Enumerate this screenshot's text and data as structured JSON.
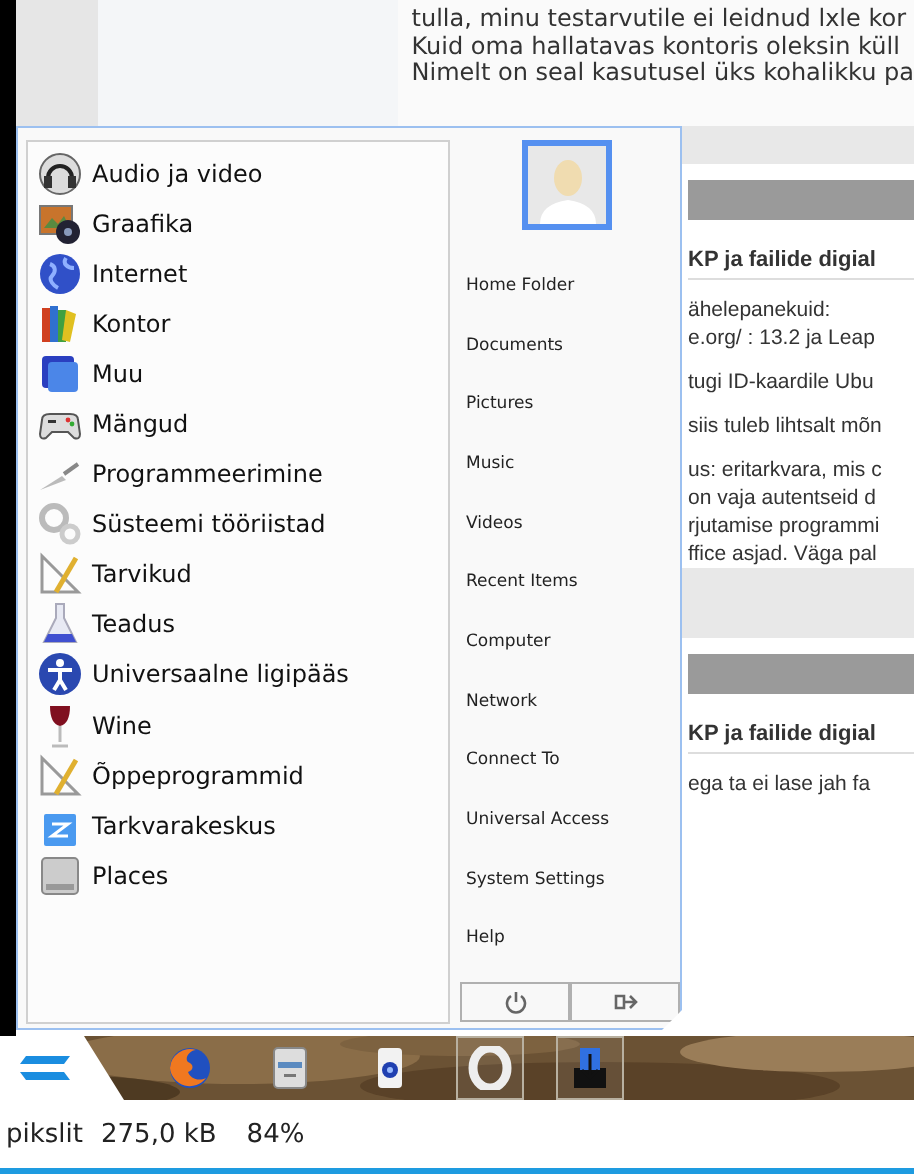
{
  "page": {
    "top_lines": [
      "tulla, minu testarvutile ei leidnud lxle kor",
      "Kuid oma hallatavas kontoris oleksin küll",
      "Nimelt on seal kasutusel üks kohalikku pa"
    ],
    "sections": [
      {
        "heading": "KP ja failide digial",
        "paragraphs": [
          [
            "ähelepanekuid:",
            "e.org/ : 13.2 ja Leap"
          ],
          [
            "tugi ID-kaardile Ubu"
          ],
          [
            "siis tuleb lihtsalt mõn"
          ],
          [
            "us: eritarkvara, mis c",
            "on vaja autentseid d",
            "rjutamise programmi",
            "ffice asjad. Väga pal"
          ]
        ]
      },
      {
        "heading": "KP ja failide digial",
        "paragraphs": [
          [
            "ega ta ei lase jah fa"
          ]
        ]
      }
    ]
  },
  "menu": {
    "categories": [
      "Audio ja video",
      "Graafika",
      "Internet",
      "Kontor",
      "Muu",
      "Mängud",
      "Programmeerimine",
      "Süsteemi tööriistad",
      "Tarvikud",
      "Teadus",
      "Universaalne ligipääs",
      "Wine",
      "Õppeprogrammid",
      "Tarkvarakeskus",
      "Places"
    ],
    "places": [
      "Home Folder",
      "Documents",
      "Pictures",
      "Music",
      "Videos",
      "Recent Items",
      "Computer",
      "Network",
      "Connect To",
      "Universal Access",
      "System Settings",
      "Help"
    ]
  },
  "taskbar": {
    "apps": [
      {
        "open": false
      },
      {
        "open": false
      },
      {
        "open": false
      },
      {
        "open": true
      },
      {
        "open": true
      }
    ]
  },
  "status_bar": [
    "pikslit",
    "275,0 kB",
    "84%"
  ]
}
